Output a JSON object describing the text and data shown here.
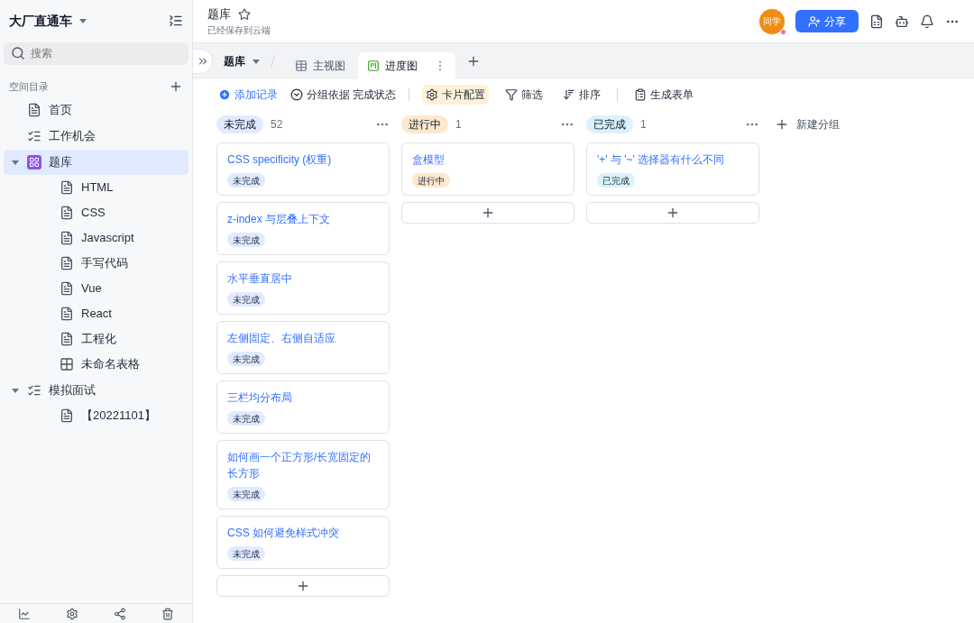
{
  "sidebar": {
    "workspace": "大厂直通车",
    "search": {
      "placeholder": "搜索"
    },
    "section": "空间目录",
    "items": [
      {
        "label": "首页",
        "kind": "doc",
        "selected": false
      },
      {
        "label": "工作机会",
        "kind": "list",
        "selected": false
      },
      {
        "label": "题库",
        "kind": "base",
        "selected": true,
        "expanded": true,
        "children": [
          {
            "label": "HTML",
            "kind": "doc",
            "selected": false
          },
          {
            "label": "CSS",
            "kind": "doc",
            "selected": false
          },
          {
            "label": "Javascript",
            "kind": "doc",
            "selected": false
          },
          {
            "label": "手写代码",
            "kind": "doc",
            "selected": false
          },
          {
            "label": "Vue",
            "kind": "doc",
            "selected": false
          },
          {
            "label": "React",
            "kind": "doc",
            "selected": false
          },
          {
            "label": "工程化",
            "kind": "doc",
            "selected": false
          },
          {
            "label": "未命名表格",
            "kind": "sheet",
            "selected": false
          }
        ]
      },
      {
        "label": "模拟面试",
        "kind": "list",
        "selected": false,
        "expanded": true,
        "children": [
          {
            "label": "【20221101】",
            "kind": "doc",
            "selected": false
          }
        ]
      }
    ]
  },
  "header": {
    "title": "题库",
    "subtitle": "已经保存到云端",
    "avatar": "同学",
    "share": "分享"
  },
  "views": {
    "table": "题库",
    "tabs": [
      {
        "label": "主视图",
        "kind": "grid",
        "selected": false
      },
      {
        "label": "进度图",
        "kind": "kanban",
        "selected": true
      }
    ]
  },
  "toolbar": {
    "add": "添加记录",
    "group_label": "分组依据",
    "group_value": "完成状态",
    "items": [
      {
        "label": "卡片配置",
        "kind": "gear",
        "selected": true
      },
      {
        "label": "筛选",
        "kind": "filter",
        "selected": false
      },
      {
        "label": "排序",
        "kind": "sort",
        "selected": false
      },
      {
        "label": "生成表单",
        "kind": "form",
        "selected": false
      }
    ]
  },
  "columns": [
    {
      "name": "未完成",
      "count": "52",
      "color": "#e1eaff",
      "cards": [
        {
          "title": "CSS specificity (权重)",
          "status": "未完成"
        },
        {
          "title": "z-index 与层叠上下文",
          "status": "未完成"
        },
        {
          "title": "水平垂直居中",
          "status": "未完成"
        },
        {
          "title": "左侧固定、右侧自适应",
          "status": "未完成"
        },
        {
          "title": "三栏均分布局",
          "status": "未完成"
        },
        {
          "title": "如何画一个正方形/长宽固定的长方形",
          "status": "未完成"
        },
        {
          "title": "CSS 如何避免样式冲突",
          "status": "未完成"
        }
      ]
    },
    {
      "name": "进行中",
      "count": "1",
      "color": "#fde8cf",
      "cards": [
        {
          "title": "盒模型",
          "status": "进行中"
        }
      ]
    },
    {
      "name": "已完成",
      "count": "1",
      "color": "#d9f2fb",
      "cards": [
        {
          "title": "'+' 与 '~' 选择器有什么不同",
          "status": "已完成"
        }
      ]
    }
  ],
  "new_group": "新建分组"
}
